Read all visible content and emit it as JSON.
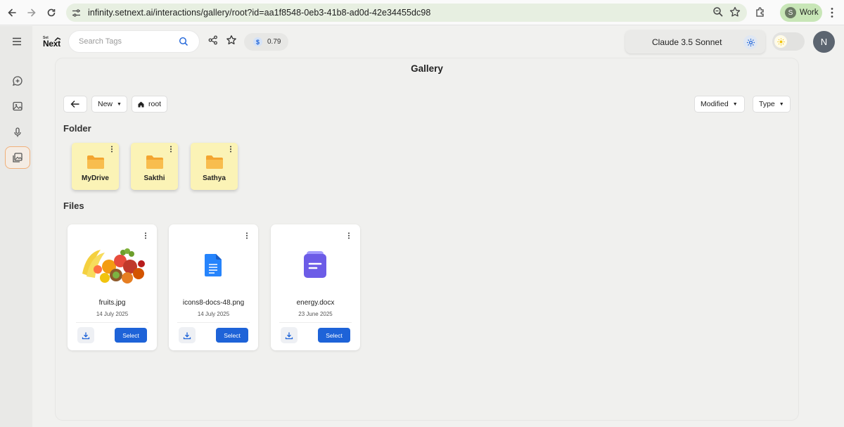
{
  "browser": {
    "url": "infinity.setnext.ai/interactions/gallery/root?id=aa1f8548-0eb3-41b8-ad0d-42e34455dc98",
    "profile_initial": "S",
    "profile_label": "Work"
  },
  "header": {
    "logo_small": "Set",
    "logo_main": "Next",
    "search_placeholder": "Search Tags",
    "credits_symbol": "$",
    "credits_value": "0.79",
    "model_name": "Claude 3.5 Sonnet",
    "avatar_initial": "N"
  },
  "gallery": {
    "title": "Gallery",
    "new_label": "New",
    "breadcrumb_root": "root",
    "sort_label": "Modified",
    "type_label": "Type",
    "folders_heading": "Folder",
    "files_heading": "Files",
    "folders": [
      {
        "name": "MyDrive"
      },
      {
        "name": "Sakthi"
      },
      {
        "name": "Sathya"
      }
    ],
    "files": [
      {
        "name": "fruits.jpg",
        "date": "14 July 2025",
        "select_label": "Select",
        "thumb": "fruit-image"
      },
      {
        "name": "icons8-docs-48.png",
        "date": "14 July 2025",
        "select_label": "Select",
        "thumb": "docs-icon"
      },
      {
        "name": "energy.docx",
        "date": "23 June 2025",
        "select_label": "Select",
        "thumb": "document-icon"
      }
    ]
  },
  "colors": {
    "accent": "#1e63d8",
    "folder_bg": "#fbf3b6",
    "active_rail": "#f0b07a"
  }
}
